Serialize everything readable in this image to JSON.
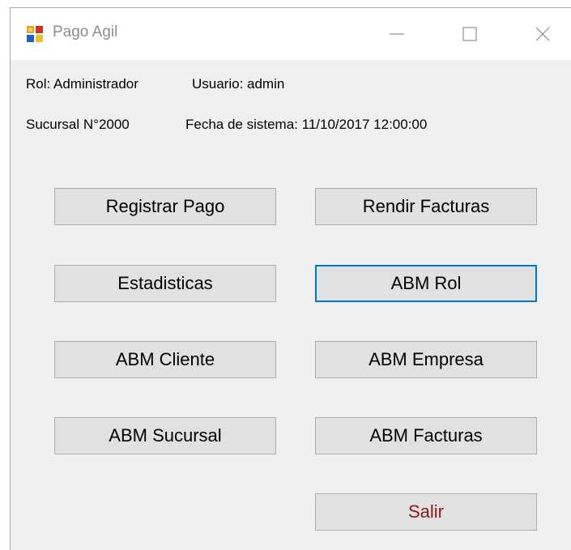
{
  "window": {
    "title": "Pago Agil",
    "icon": "winforms-app-icon"
  },
  "info": {
    "role_label": "Rol: Administrador",
    "user_label": "Usuario: admin",
    "branch_label": "Sucursal N°2000",
    "system_date_label": "Fecha de sistema: 11/10/2017 12:00:00"
  },
  "buttons": {
    "registrar_pago": "Registrar Pago",
    "rendir_facturas": "Rendir Facturas",
    "estadisticas": "Estadisticas",
    "abm_rol": "ABM Rol",
    "abm_cliente": "ABM Cliente",
    "abm_empresa": "ABM Empresa",
    "abm_sucursal": "ABM Sucursal",
    "abm_facturas": "ABM Facturas",
    "salir": "Salir"
  },
  "colors": {
    "focus_border": "#0078d7",
    "exit_text": "#8b1a1a",
    "button_face": "#e1e1e1",
    "window_bg": "#f0f0f0"
  }
}
